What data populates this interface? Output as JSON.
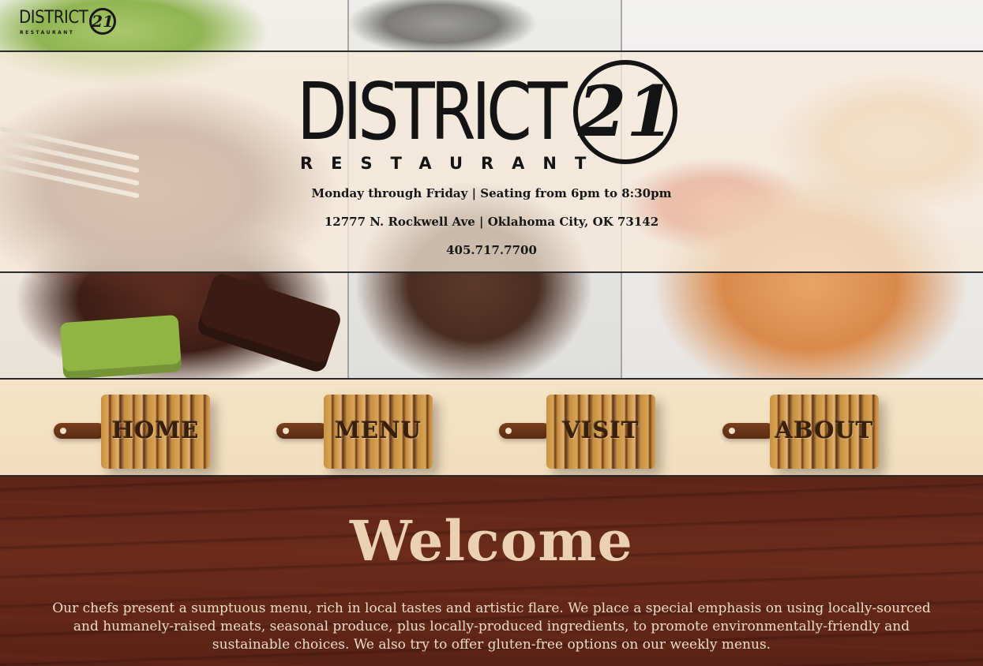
{
  "brand": {
    "name": "DISTRICT",
    "number": "21",
    "tagline": "RESTAURANT"
  },
  "info": {
    "hours": "Monday through Friday | Seating from 6pm to 8:30pm",
    "address": "12777 N. Rockwell Ave | Oklahoma City, OK 73142",
    "phone": "405.717.7700"
  },
  "nav": {
    "items": [
      {
        "label": "HOME"
      },
      {
        "label": "MENU"
      },
      {
        "label": "VISIT"
      },
      {
        "label": "ABOUT"
      }
    ]
  },
  "welcome": {
    "heading": "Welcome",
    "body": "Our chefs present a sumptuous menu, rich in local tastes and artistic flare. We place a special emphasis on using locally-sourced and humanely-raised meats, seasonal produce, plus locally-produced ingredients, to promote environmentally-friendly and sustainable choices. We also try to offer gluten-free options on our weekly menus."
  },
  "colors": {
    "header_panel": "#f5ead8",
    "nav_strip": "#f4e0c2",
    "wood_dark": "#5d2418",
    "welcome_heading": "#ead1b4",
    "text_dark": "#171717"
  }
}
